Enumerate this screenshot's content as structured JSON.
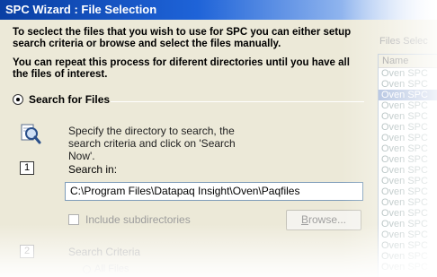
{
  "window": {
    "title": "SPC Wizard : File Selection"
  },
  "intro": {
    "line1": "To seclect the files that you wish to use for SPC you can either setup search criteria or browse and select the files manually.",
    "line2": "You can repeat this process for diferent directories until you have all the files of interest."
  },
  "search_section": {
    "radio_label": "Search for Files",
    "radio_selected": true,
    "icon": "search-files-icon",
    "instructions": "Specify the directory to search, the search criteria and click on 'Search Now'.",
    "step1_number": "1",
    "search_in_label": "Search in:",
    "search_in_value": "C:\\Program Files\\Datapaq Insight\\Oven\\Paqfiles",
    "include_subdirectories_label": "Include subdirectories",
    "include_subdirectories_checked": false,
    "browse_button_pre": "B",
    "browse_button_rest": "rowse...",
    "step2_number": "2",
    "search_criteria_label": "Search Criteria",
    "all_files_label": "All Files"
  },
  "files_panel": {
    "label": "Files Selec",
    "column_header": "Name",
    "items": [
      "Oven SPC",
      "Oven SPC",
      "Oven SPC",
      "Oven SPC",
      "Oven SPC",
      "Oven SPC",
      "Oven SPC",
      "Oven SPC",
      "Oven SPC",
      "Oven SPC",
      "Oven SPC",
      "Oven SPC",
      "Oven SPC",
      "Oven SPC",
      "Oven SPC",
      "Oven SPC",
      "Oven SPC",
      "Oven SPC",
      "Oven SPC"
    ],
    "selected_index": 2
  },
  "colors": {
    "titlebar_start": "#0a3fa3",
    "titlebar_end": "#ffffff",
    "dialog_bg": "#ece9d8",
    "selection": "#9db2d8"
  }
}
